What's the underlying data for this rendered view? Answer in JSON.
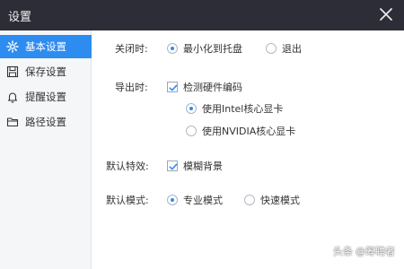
{
  "window": {
    "title": "设置"
  },
  "sidebar": {
    "items": [
      {
        "label": "基本设置",
        "icon": "gear-icon",
        "active": true
      },
      {
        "label": "保存设置",
        "icon": "save-icon",
        "active": false
      },
      {
        "label": "提醒设置",
        "icon": "bell-icon",
        "active": false
      },
      {
        "label": "路径设置",
        "icon": "folder-icon",
        "active": false
      }
    ]
  },
  "settings": {
    "close": {
      "label": "关闭时:",
      "options": [
        {
          "label": "最小化到托盘",
          "selected": true
        },
        {
          "label": "退出",
          "selected": false
        }
      ]
    },
    "export": {
      "label": "导出时:",
      "checkbox": {
        "label": "检测硬件编码",
        "checked": true
      },
      "options": [
        {
          "label": "使用Intel核心显卡",
          "selected": true
        },
        {
          "label": "使用NVIDIA核心显卡",
          "selected": false
        }
      ]
    },
    "effects": {
      "label": "默认特效:",
      "checkbox": {
        "label": "模糊背景",
        "checked": true
      }
    },
    "mode": {
      "label": "默认模式:",
      "options": [
        {
          "label": "专业模式",
          "selected": true
        },
        {
          "label": "快速模式",
          "selected": false
        }
      ]
    }
  },
  "watermark": {
    "prefix": "头条",
    "handle": "@筹聘者"
  },
  "colors": {
    "titlebar": "#2c2d36",
    "accent": "#2d8cf0",
    "sidebar": "#f5f6f8"
  }
}
